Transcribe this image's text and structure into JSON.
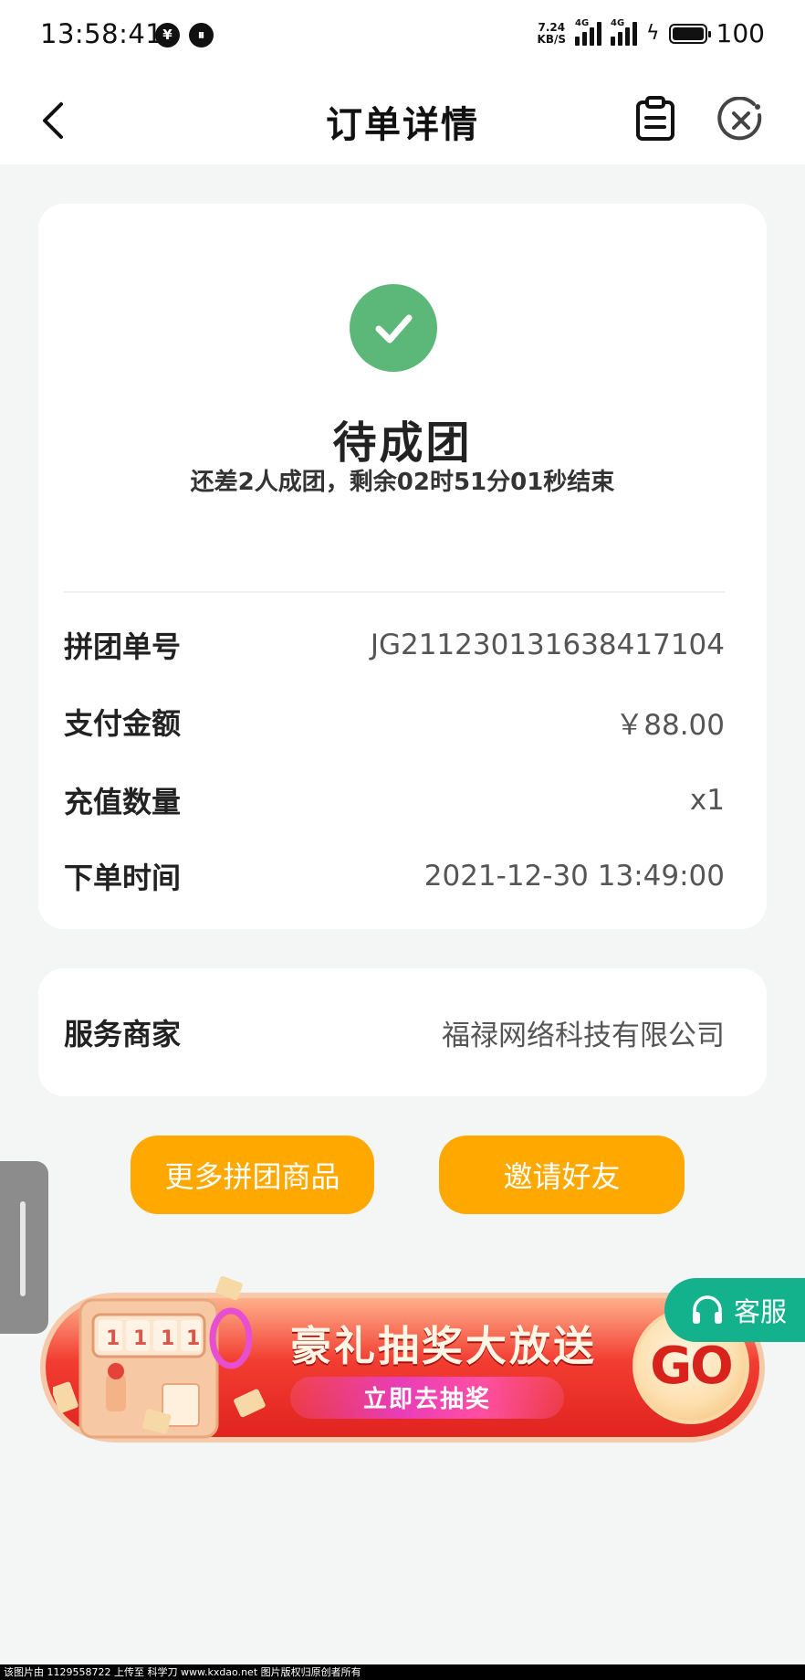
{
  "status_bar": {
    "time": "13:58:41",
    "left_icons": [
      "shield-yen-icon",
      "pause-circle-icon"
    ],
    "speed_value": "7.24",
    "speed_unit": "KB/S",
    "network_1": "4G",
    "network_2": "4G",
    "battery_level": "100"
  },
  "header": {
    "title": "订单详情",
    "icons": [
      "back-arrow-icon",
      "clipboard-icon",
      "close-circle-icon"
    ]
  },
  "order": {
    "status_title": "待成团",
    "status_subtitle": "还差2人成团，剩余02时51分01秒结束",
    "rows": [
      {
        "label": "拼团单号",
        "value": "JG211230131638417104"
      },
      {
        "label": "支付金额",
        "value": "￥88.00"
      },
      {
        "label": "充值数量",
        "value": "x1"
      },
      {
        "label": "下单时间",
        "value": "2021-12-30 13:49:00"
      }
    ]
  },
  "merchant": {
    "label": "服务商家",
    "value": "福禄网络科技有限公司"
  },
  "buttons": {
    "more_label": "更多拼团商品",
    "invite_label": "邀请好友"
  },
  "banner": {
    "title": "豪礼抽奖大放送",
    "subtitle": "立即去抽奖",
    "go_label": "GO",
    "machine_label": "1111"
  },
  "customer_service": {
    "label": "客服"
  },
  "watermark": {
    "text": "该图片由 1129558722 上传至 科学刀 www.kxdao.net 图片版权归原创者所有"
  },
  "colors": {
    "accent_orange": "#ffa800",
    "success_green": "#5cb878",
    "cs_teal": "#14b28c"
  }
}
